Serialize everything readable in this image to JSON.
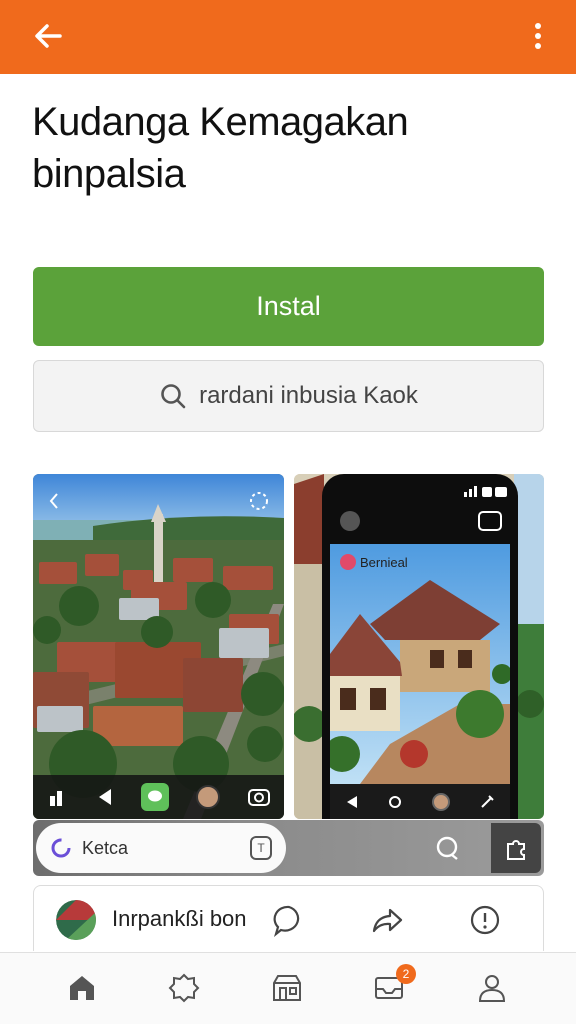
{
  "header": {
    "back_icon": "arrow-left-icon",
    "more_icon": "more-vertical-icon",
    "color": "#f06a1c"
  },
  "app": {
    "title_line1": "Kudanga Kemaɡakan",
    "title_line2": "binpalsia"
  },
  "install": {
    "label": "Instal",
    "color": "#5ba23a"
  },
  "search": {
    "text": "rardani inbusia Kaok",
    "icon": "search-icon"
  },
  "screenshot2": {
    "app_title": "Bernieal"
  },
  "overlay": {
    "pill_label": "Ketca",
    "tag_icon": "tag-icon"
  },
  "card": {
    "label": "Inrpankßi bon"
  },
  "bottom_nav": {
    "items": [
      "home-icon",
      "explore-icon",
      "store-icon",
      "inbox-icon",
      "profile-icon"
    ],
    "badge": "2"
  }
}
